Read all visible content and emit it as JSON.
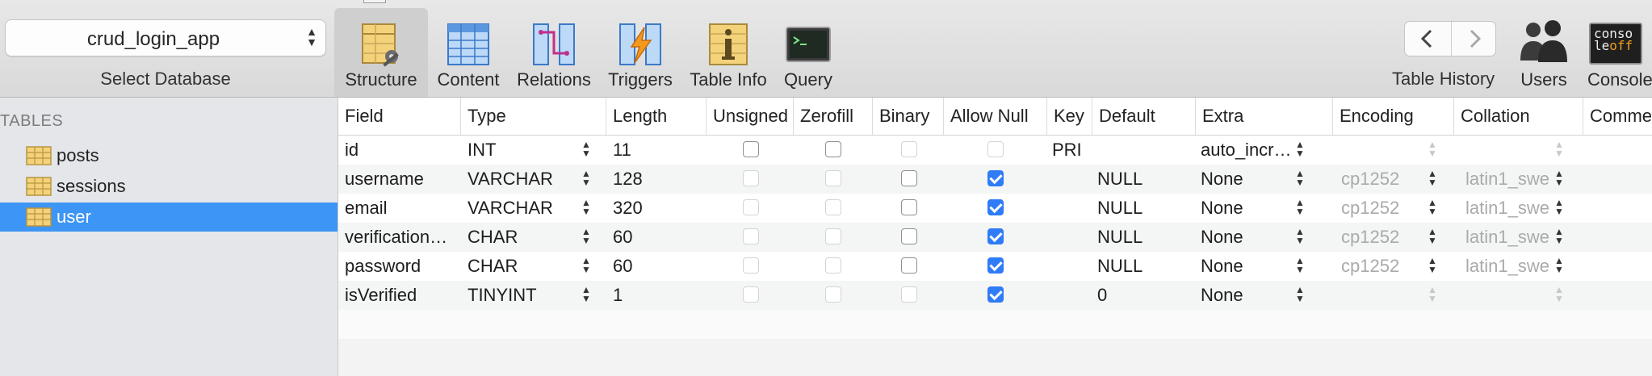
{
  "toolbar": {
    "database": {
      "value": "crud_login_app",
      "label": "Select Database"
    },
    "tabs": [
      {
        "label": "Structure",
        "icon": "structure-icon",
        "active": true
      },
      {
        "label": "Content",
        "icon": "content-icon"
      },
      {
        "label": "Relations",
        "icon": "relations-icon"
      },
      {
        "label": "Triggers",
        "icon": "triggers-icon"
      },
      {
        "label": "Table Info",
        "icon": "table-info-icon"
      },
      {
        "label": "Query",
        "icon": "query-icon"
      }
    ],
    "history_label": "Table History",
    "users_label": "Users",
    "console_label": "Console",
    "console_icon_text_top": "conso",
    "console_icon_text_mid": "le",
    "console_icon_text_off": "off"
  },
  "sidebar": {
    "header": "TABLES",
    "tables": [
      {
        "name": "posts",
        "selected": false
      },
      {
        "name": "sessions",
        "selected": false
      },
      {
        "name": "user",
        "selected": true
      }
    ]
  },
  "structure": {
    "columns": [
      "Field",
      "Type",
      "Length",
      "Unsigned",
      "Zerofill",
      "Binary",
      "Allow Null",
      "Key",
      "Default",
      "Extra",
      "Encoding",
      "Collation",
      "Comment"
    ],
    "rows": [
      {
        "field": "id",
        "type": "INT",
        "length": "11",
        "unsigned": false,
        "zerofill": false,
        "binary": false,
        "allow_null": false,
        "key": "PRI",
        "default": "",
        "extra": "auto_incr…",
        "encoding": "",
        "collation": ""
      },
      {
        "field": "username",
        "type": "VARCHAR",
        "length": "128",
        "unsigned": false,
        "zerofill": false,
        "binary": false,
        "allow_null": true,
        "key": "",
        "default": "NULL",
        "extra": "None",
        "encoding": "cp1252",
        "collation": "latin1_swe"
      },
      {
        "field": "email",
        "type": "VARCHAR",
        "length": "320",
        "unsigned": false,
        "zerofill": false,
        "binary": false,
        "allow_null": true,
        "key": "",
        "default": "NULL",
        "extra": "None",
        "encoding": "cp1252",
        "collation": "latin1_swe"
      },
      {
        "field": "verification…",
        "type": "CHAR",
        "length": "60",
        "unsigned": false,
        "zerofill": false,
        "binary": false,
        "allow_null": true,
        "key": "",
        "default": "NULL",
        "extra": "None",
        "encoding": "cp1252",
        "collation": "latin1_swe"
      },
      {
        "field": "password",
        "type": "CHAR",
        "length": "60",
        "unsigned": false,
        "zerofill": false,
        "binary": false,
        "allow_null": true,
        "key": "",
        "default": "NULL",
        "extra": "None",
        "encoding": "cp1252",
        "collation": "latin1_swe"
      },
      {
        "field": "isVerified",
        "type": "TINYINT",
        "length": "1",
        "unsigned": false,
        "zerofill": false,
        "binary": false,
        "allow_null": true,
        "key": "",
        "default": "0",
        "extra": "None",
        "encoding": "",
        "collation": ""
      }
    ]
  },
  "colors": {
    "selection": "#3d95f5",
    "checkbox_on": "#2f7cf6",
    "sidebar_bg": "#e4e6ea"
  }
}
